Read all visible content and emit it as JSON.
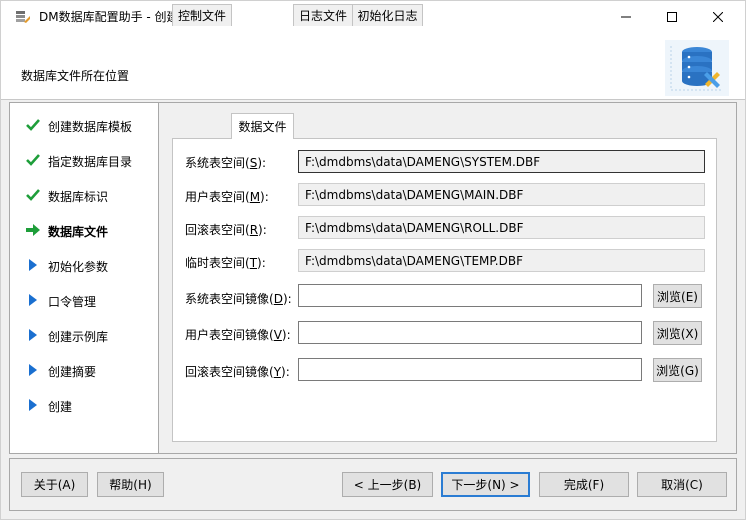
{
  "window": {
    "title": "DM数据库配置助手 - 创建数据库"
  },
  "header": {
    "label": "数据库文件所在位置"
  },
  "steps": [
    {
      "label": "创建数据库模板",
      "state": "done"
    },
    {
      "label": "指定数据库目录",
      "state": "done"
    },
    {
      "label": "数据库标识",
      "state": "done"
    },
    {
      "label": "数据库文件",
      "state": "current"
    },
    {
      "label": "初始化参数",
      "state": "pending"
    },
    {
      "label": "口令管理",
      "state": "pending"
    },
    {
      "label": "创建示例库",
      "state": "pending"
    },
    {
      "label": "创建摘要",
      "state": "pending"
    },
    {
      "label": "创建",
      "state": "pending"
    }
  ],
  "tabs": [
    {
      "label": "控制文件",
      "active": false
    },
    {
      "label": "数据文件",
      "active": true
    },
    {
      "label": "日志文件",
      "active": false
    },
    {
      "label": "初始化日志",
      "active": false
    }
  ],
  "fields": {
    "system": {
      "label": "系统表空间(",
      "key": "S",
      "suffix": "):",
      "value": "F:\\dmdbms\\data\\DAMENG\\SYSTEM.DBF"
    },
    "user": {
      "label": "用户表空间(",
      "key": "M",
      "suffix": "):",
      "value": "F:\\dmdbms\\data\\DAMENG\\MAIN.DBF"
    },
    "rollback": {
      "label": "回滚表空间(",
      "key": "R",
      "suffix": "):",
      "value": "F:\\dmdbms\\data\\DAMENG\\ROLL.DBF"
    },
    "temp": {
      "label": "临时表空间(",
      "key": "T",
      "suffix": "):",
      "value": "F:\\dmdbms\\data\\DAMENG\\TEMP.DBF"
    }
  },
  "mirrors": {
    "system": {
      "label": "系统表空间镜像(",
      "key": "D",
      "suffix": "):",
      "value": "",
      "browse": "浏览(E)"
    },
    "user": {
      "label": "用户表空间镜像(",
      "key": "V",
      "suffix": "):",
      "value": "",
      "browse": "浏览(X)"
    },
    "rollback": {
      "label": "回滚表空间镜像(",
      "key": "Y",
      "suffix": "):",
      "value": "",
      "browse": "浏览(G)"
    }
  },
  "buttons": {
    "about": "关于(A)",
    "help": "帮助(H)",
    "prev": "< 上一步(B)",
    "next": "下一步(N) >",
    "finish": "完成(F)",
    "cancel": "取消(C)"
  },
  "colors": {
    "check": "#1e9e3a",
    "current_arrow": "#1e9e3a",
    "pending_arrow": "#1a6fd0",
    "default_button_border": "#2a7cd3"
  }
}
